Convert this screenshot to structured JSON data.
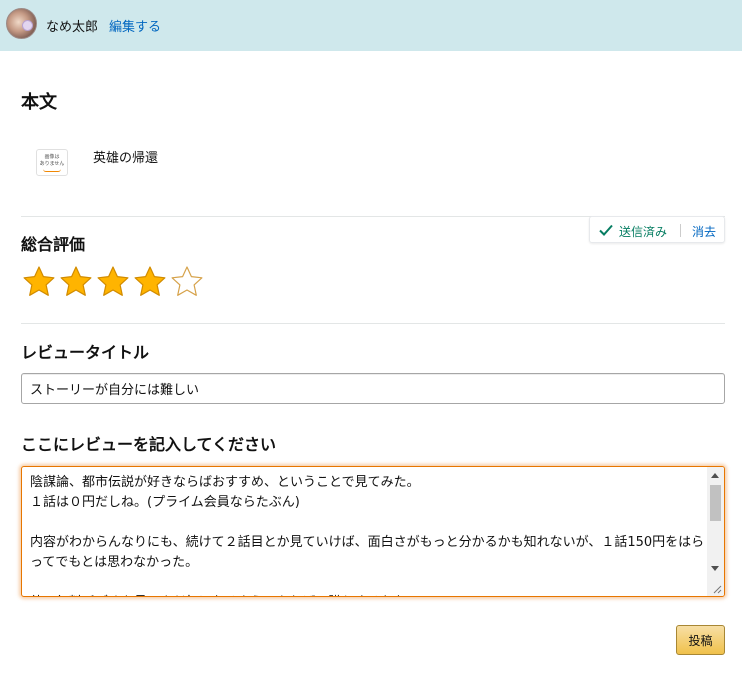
{
  "header": {
    "username": "なめ太郎",
    "edit_link": "編集する"
  },
  "main": {
    "title": "本文",
    "product": {
      "image_placeholder_line1": "画像は",
      "image_placeholder_line2": "ありません",
      "name": "英雄の帰還"
    }
  },
  "rating": {
    "title": "総合評価",
    "value": 4,
    "max": 5,
    "status_label": "送信済み",
    "clear_link": "消去",
    "star_color": "#ffb400"
  },
  "review_title": {
    "label": "レビュータイトル",
    "value": "ストーリーが自分には難しい"
  },
  "review_body": {
    "label": "ここにレビューを記入してください",
    "paragraphs": [
      "陰謀論、都市伝説が好きならばおすすめ、ということで見てみた。\n１話は０円だしね。(プライム会員ならたぶん)",
      "内容がわからんなりにも、続けて２話目とか見ていけば、面白さがもっと分かるかも知れないが、１話150円をはらってでもとは思わなかった。",
      "他の無料ビデオを見てまだ気になるようであれば、購入するかな。"
    ]
  },
  "submit": {
    "label": "投稿"
  },
  "colors": {
    "header_bg": "#cfe8ec",
    "link": "#0066c0",
    "focus_border": "#e77600",
    "button_bg": "#f0c14b"
  }
}
